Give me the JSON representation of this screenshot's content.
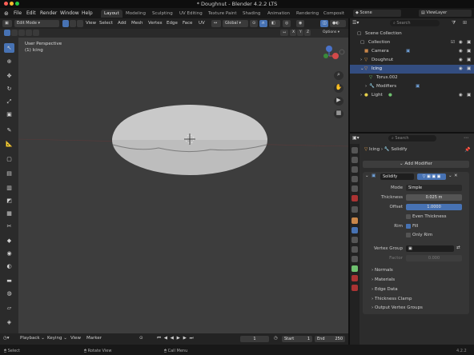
{
  "window": {
    "title": "* Doughnut - Blender 4.2.2 LTS"
  },
  "menubar": {
    "app_icon": "blender-icon",
    "items": [
      "File",
      "Edit",
      "Render",
      "Window",
      "Help"
    ],
    "workspaces": [
      "Layout",
      "Modeling",
      "Sculpting",
      "UV Editing",
      "Texture Paint",
      "Shading",
      "Animation",
      "Rendering",
      "Composit"
    ],
    "scene_label": "Scene",
    "view_layer_label": "ViewLayer"
  },
  "viewport_header": {
    "mode": "Edit Mode",
    "menus": [
      "View",
      "Select",
      "Add",
      "Mesh",
      "Vertex",
      "Edge",
      "Face",
      "UV"
    ],
    "transform": "Global",
    "axes": [
      "X",
      "Y",
      "Z"
    ],
    "options": "Options"
  },
  "viewport": {
    "perspective": "User Perspective",
    "object_label": "(1) Icing"
  },
  "outliner": {
    "search_placeholder": "Search",
    "rows": [
      {
        "label": "Scene Collection"
      },
      {
        "label": "Collection"
      },
      {
        "label": "Camera"
      },
      {
        "label": "Doughnut"
      },
      {
        "label": "Icing"
      },
      {
        "label": "Torus.002"
      },
      {
        "label": "Modifiers"
      },
      {
        "label": "Light"
      }
    ]
  },
  "properties": {
    "search_placeholder": "Search",
    "breadcrumb": [
      "Icing",
      "Solidify"
    ],
    "add_modifier": "Add Modifier",
    "modifier_name": "Solidify",
    "mode_label": "Mode",
    "mode_value": "Simple",
    "thickness_label": "Thickness",
    "thickness_value": "0.025 m",
    "offset_label": "Offset",
    "offset_value": "1.0000",
    "even_thickness_label": "Even Thickness",
    "rim_label": "Rim",
    "fill_label": "Fill",
    "only_rim_label": "Only Rim",
    "vertex_group_label": "Vertex Group",
    "factor_label": "Factor",
    "factor_value": "0.000",
    "subpanels": [
      "Normals",
      "Materials",
      "Edge Data",
      "Thickness Clamp",
      "Output Vertex Groups"
    ]
  },
  "timeline": {
    "menus": [
      "Playback",
      "Keying",
      "View",
      "Marker"
    ],
    "current_frame": "1",
    "start_label": "Start",
    "start_value": "1",
    "end_label": "End",
    "end_value": "250"
  },
  "statusbar": {
    "items": [
      "Select",
      "Rotate View",
      "Call Menu"
    ],
    "version": "4.2.2"
  },
  "colors": {
    "accent": "#4772b3",
    "selection": "#334d80",
    "background": "#3d3d3d"
  }
}
